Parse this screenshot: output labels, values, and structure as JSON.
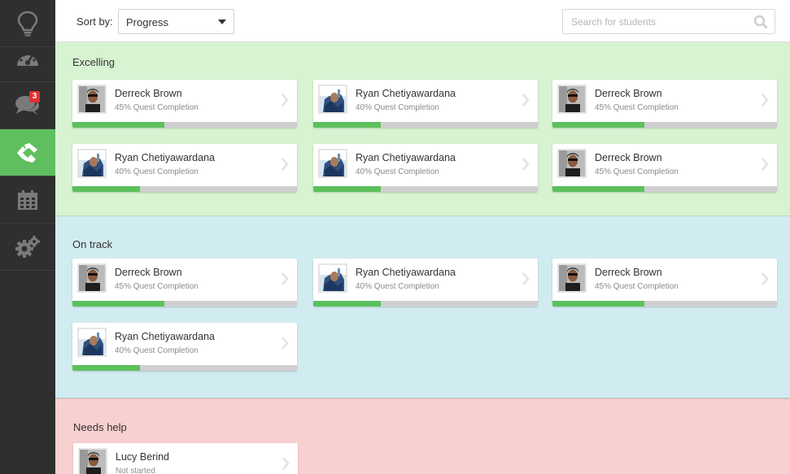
{
  "sidebar": {
    "active_index": 3,
    "items": [
      {
        "icon": "lightbulb-icon"
      },
      {
        "icon": "dashboard-gauge-icon"
      },
      {
        "icon": "chat-bubbles-icon",
        "badge": "3"
      },
      {
        "icon": "students-hands-icon"
      },
      {
        "icon": "calendar-icon"
      },
      {
        "icon": "settings-gears-icon"
      }
    ]
  },
  "toolbar": {
    "sort_label": "Sort by:",
    "sort_value": "Progress",
    "search_placeholder": "Search for students"
  },
  "sections": [
    {
      "title": "Excelling",
      "students": [
        {
          "name": "Derreck Brown",
          "status": "45% Quest Completion",
          "progress": 0.41,
          "avatar": "derreck"
        },
        {
          "name": "Ryan Chetiyawardana",
          "status": "40% Quest Completion",
          "progress": 0.3,
          "avatar": "ryan"
        },
        {
          "name": "Derreck Brown",
          "status": "45% Quest Completion",
          "progress": 0.41,
          "avatar": "derreck"
        },
        {
          "name": "Ryan Chetiyawardana",
          "status": "40% Quest Completion",
          "progress": 0.3,
          "avatar": "ryan"
        },
        {
          "name": "Ryan Chetiyawardana",
          "status": "40% Quest Completion",
          "progress": 0.3,
          "avatar": "ryan"
        },
        {
          "name": "Derreck Brown",
          "status": "45% Quest Completion",
          "progress": 0.41,
          "avatar": "derreck"
        }
      ]
    },
    {
      "title": "On track",
      "students": [
        {
          "name": "Derreck Brown",
          "status": "45% Quest Completion",
          "progress": 0.41,
          "avatar": "derreck"
        },
        {
          "name": "Ryan Chetiyawardana",
          "status": "40% Quest Completion",
          "progress": 0.3,
          "avatar": "ryan"
        },
        {
          "name": "Derreck Brown",
          "status": "45% Quest Completion",
          "progress": 0.41,
          "avatar": "derreck"
        },
        {
          "name": "Ryan Chetiyawardana",
          "status": "40% Quest Completion",
          "progress": 0.3,
          "avatar": "ryan"
        }
      ]
    },
    {
      "title": "Needs help",
      "students": [
        {
          "name": "Lucy Berind",
          "status": "Not started",
          "progress": 0,
          "avatar": "derreck"
        }
      ]
    }
  ],
  "colors": {
    "sidebar_bg": "#2f2f2f",
    "active_nav": "#5fbf5f",
    "excelling_bg": "#d7f3d2",
    "ontrack_bg": "#d1ecf1",
    "needshelp_bg": "#f7d0cf",
    "progress_fill": "#5cc05c",
    "badge": "#e03030"
  }
}
